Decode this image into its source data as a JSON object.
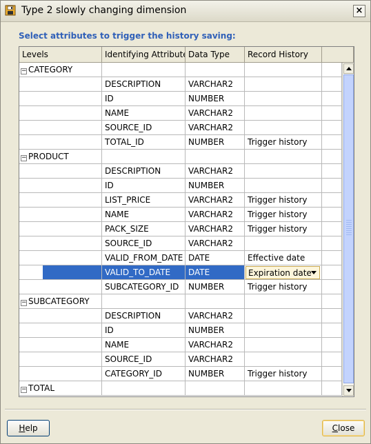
{
  "window": {
    "title": "Type 2 slowly changing dimension",
    "close_glyph": "×"
  },
  "instruction": "Select attributes to trigger the history saving:",
  "table": {
    "headers": [
      "Levels",
      "Identifying Attribute",
      "Data Type",
      "Record History"
    ],
    "rows": [
      {
        "level": "CATEGORY",
        "expander": "−"
      },
      {
        "attr": "DESCRIPTION",
        "type": "VARCHAR2",
        "history": ""
      },
      {
        "attr": "ID",
        "type": "NUMBER",
        "history": ""
      },
      {
        "attr": "NAME",
        "type": "VARCHAR2",
        "history": ""
      },
      {
        "attr": "SOURCE_ID",
        "type": "VARCHAR2",
        "history": ""
      },
      {
        "attr": "TOTAL_ID",
        "type": "NUMBER",
        "history": "Trigger history"
      },
      {
        "level": "PRODUCT",
        "expander": "−"
      },
      {
        "attr": "DESCRIPTION",
        "type": "VARCHAR2",
        "history": ""
      },
      {
        "attr": "ID",
        "type": "NUMBER",
        "history": ""
      },
      {
        "attr": "LIST_PRICE",
        "type": "VARCHAR2",
        "history": "Trigger history"
      },
      {
        "attr": "NAME",
        "type": "VARCHAR2",
        "history": "Trigger history"
      },
      {
        "attr": "PACK_SIZE",
        "type": "VARCHAR2",
        "history": "Trigger history"
      },
      {
        "attr": "SOURCE_ID",
        "type": "VARCHAR2",
        "history": ""
      },
      {
        "attr": "VALID_FROM_DATE",
        "type": "DATE",
        "history": "Effective date"
      },
      {
        "attr": "VALID_TO_DATE",
        "type": "DATE",
        "history": "Expiration date",
        "selected": true,
        "dropdown": true
      },
      {
        "attr": "SUBCATEGORY_ID",
        "type": "NUMBER",
        "history": "Trigger history"
      },
      {
        "level": "SUBCATEGORY",
        "expander": "−"
      },
      {
        "attr": "DESCRIPTION",
        "type": "VARCHAR2",
        "history": ""
      },
      {
        "attr": "ID",
        "type": "NUMBER",
        "history": ""
      },
      {
        "attr": "NAME",
        "type": "VARCHAR2",
        "history": ""
      },
      {
        "attr": "SOURCE_ID",
        "type": "VARCHAR2",
        "history": ""
      },
      {
        "attr": "CATEGORY_ID",
        "type": "NUMBER",
        "history": "Trigger history"
      },
      {
        "level": "TOTAL",
        "expander": "−"
      }
    ]
  },
  "buttons": {
    "help": {
      "mnemonic": "H",
      "rest": "elp"
    },
    "close": {
      "mnemonic": "C",
      "rest": "lose"
    }
  },
  "colors": {
    "selection": "#316ac5",
    "instruction_text": "#3060b8",
    "dialog_bg": "#ece9d8"
  }
}
